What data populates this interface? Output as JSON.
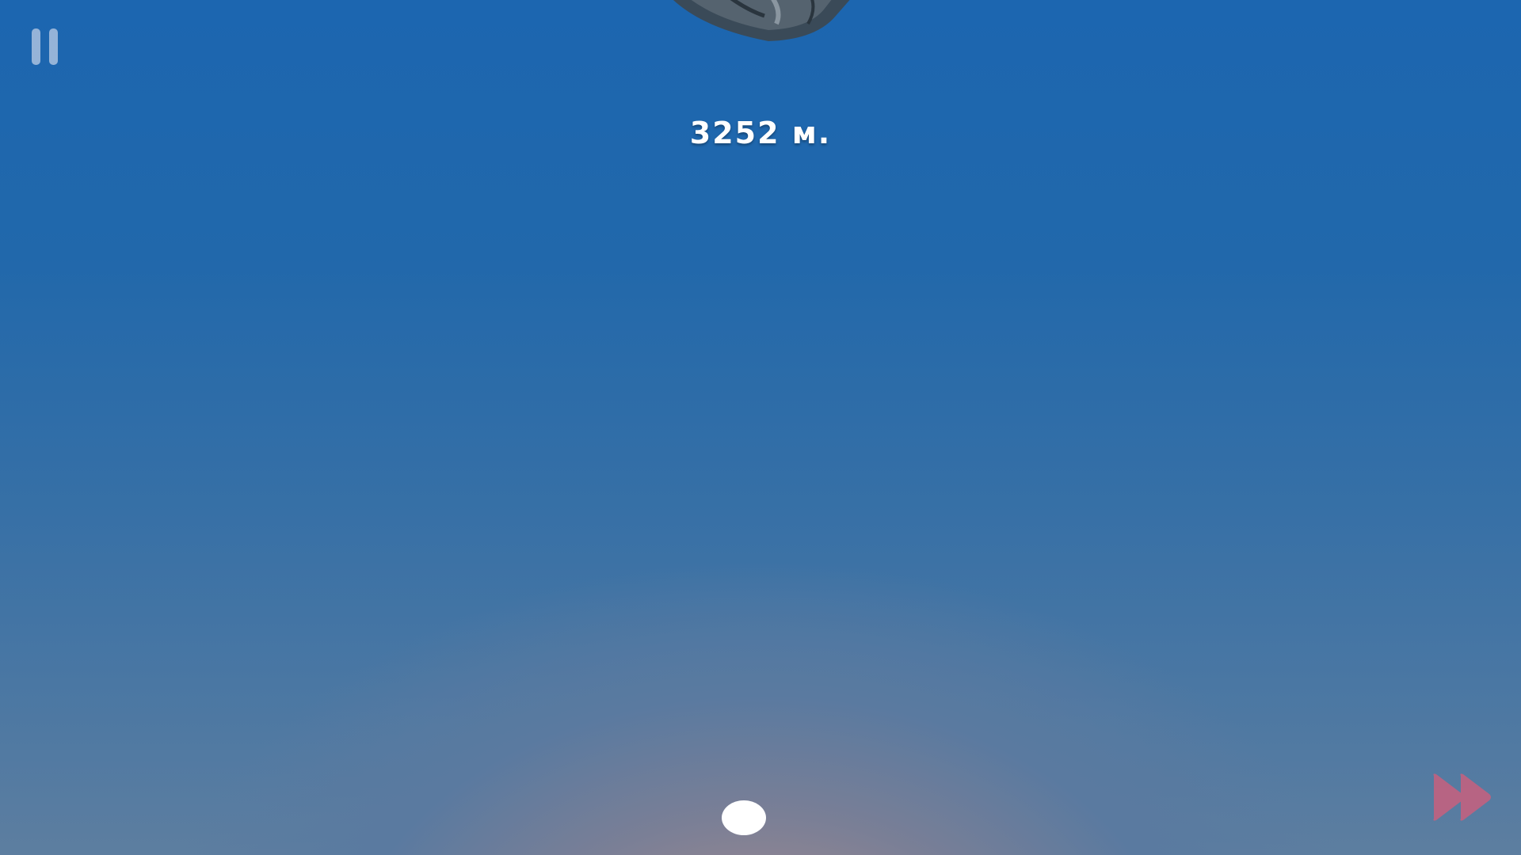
{
  "hud": {
    "altitude_text": "3252 м.",
    "pause_icon": "pause-icon",
    "fast_forward_icon": "fast-forward-icon"
  },
  "colors": {
    "sky_top": "#1c66b0",
    "horizon_glow": "#b8958a",
    "pause_icon": "#becde6",
    "fast_forward_icon": "#c8607e",
    "altitude_text": "#ffffff",
    "capsule": "#3a4a58"
  }
}
